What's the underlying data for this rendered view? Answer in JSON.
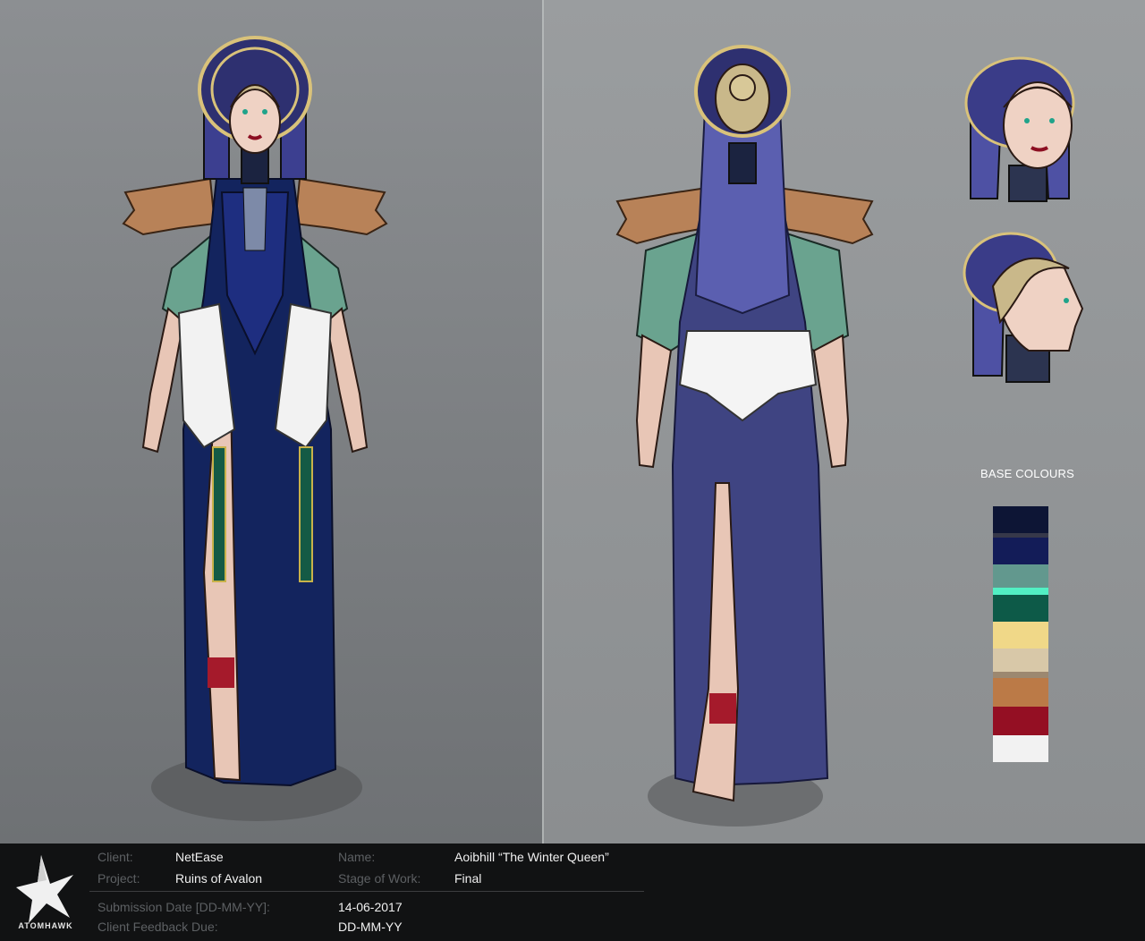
{
  "sheet": {
    "base_colours_title": "BASE COLOURS",
    "swatches": [
      {
        "color": "#0d1535",
        "h": 30
      },
      {
        "color": "#36384a",
        "h": 5
      },
      {
        "color": "#131c58",
        "h": 30
      },
      {
        "color": "#62988e",
        "h": 26
      },
      {
        "color": "#52f0c4",
        "h": 8
      },
      {
        "color": "#0d5a48",
        "h": 30
      },
      {
        "color": "#f0d888",
        "h": 30
      },
      {
        "color": "#d8c8a8",
        "h": 26
      },
      {
        "color": "#9c8870",
        "h": 7
      },
      {
        "color": "#bb7a47",
        "h": 32
      },
      {
        "color": "#940f23",
        "h": 32
      },
      {
        "color": "#f2f2f2",
        "h": 30
      }
    ]
  },
  "footer": {
    "brand": "ATOMHAWK",
    "client_label": "Client:",
    "client_value": "NetEase",
    "project_label": "Project:",
    "project_value": "Ruins of Avalon",
    "name_label": "Name:",
    "name_value": "Aoibhill “The Winter Queen”",
    "stage_label": "Stage of Work:",
    "stage_value": "Final",
    "submission_label": "Submission Date [DD-MM-YY]:",
    "submission_value": "14-06-2017",
    "feedback_label": "Client Feedback Due:",
    "feedback_value": "DD-MM-YY"
  }
}
